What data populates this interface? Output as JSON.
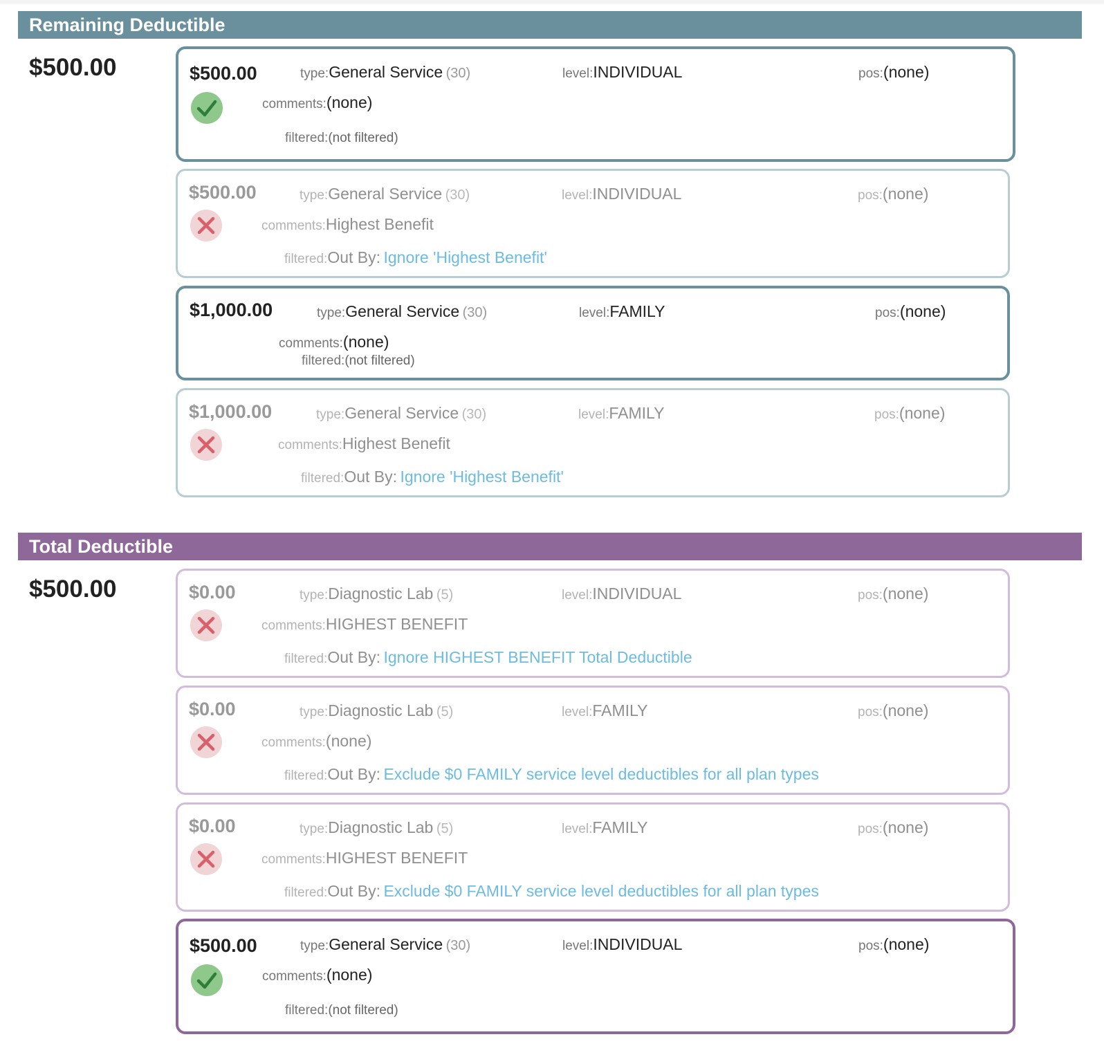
{
  "colors": {
    "remaining_accent": "#6a909e",
    "remaining_faint": "#b8ccd4",
    "total_accent": "#8f689a",
    "total_faint": "#d2bcdb",
    "link": "#6cbbe0",
    "check_bg": "#8ec98b",
    "check_mark": "#2f7d3a",
    "x_bg": "#f0d4d6",
    "x_mark": "#d9606a"
  },
  "labels": {
    "type": "type:",
    "level": "level:",
    "pos": "pos:",
    "comments": "comments:",
    "filtered": "filtered:",
    "out_by": "Out By:"
  },
  "sections": [
    {
      "title": "Remaining Deductible",
      "amount": "$500.00",
      "cards": [
        {
          "amount": "$500.00",
          "type": "General Service",
          "type_code": "(30)",
          "level": "INDIVIDUAL",
          "pos": "(none)",
          "comments": "(none)",
          "filtered_text": "(not filtered)",
          "filtered_link": "",
          "status": "pass",
          "icon": "check-icon"
        },
        {
          "amount": "$500.00",
          "type": "General Service",
          "type_code": "(30)",
          "level": "INDIVIDUAL",
          "pos": "(none)",
          "comments": "Highest Benefit",
          "filtered_text": "",
          "filtered_link": "Ignore 'Highest Benefit'",
          "status": "fail",
          "icon": "x-icon"
        },
        {
          "amount": "$1,000.00",
          "type": "General Service",
          "type_code": "(30)",
          "level": "FAMILY",
          "pos": "(none)",
          "comments": "(none)",
          "filtered_text": "(not filtered)",
          "filtered_link": "",
          "status": "pass",
          "icon": ""
        },
        {
          "amount": "$1,000.00",
          "type": "General Service",
          "type_code": "(30)",
          "level": "FAMILY",
          "pos": "(none)",
          "comments": "Highest Benefit",
          "filtered_text": "",
          "filtered_link": "Ignore 'Highest Benefit'",
          "status": "fail",
          "icon": "x-icon"
        }
      ]
    },
    {
      "title": "Total Deductible",
      "amount": "$500.00",
      "cards": [
        {
          "amount": "$0.00",
          "type": "Diagnostic Lab",
          "type_code": "(5)",
          "level": "INDIVIDUAL",
          "pos": "(none)",
          "comments": "HIGHEST BENEFIT",
          "filtered_text": "",
          "filtered_link": "Ignore HIGHEST BENEFIT Total Deductible",
          "status": "fail",
          "icon": "x-icon"
        },
        {
          "amount": "$0.00",
          "type": "Diagnostic Lab",
          "type_code": "(5)",
          "level": "FAMILY",
          "pos": "(none)",
          "comments": "(none)",
          "filtered_text": "",
          "filtered_link": "Exclude $0 FAMILY service level deductibles for all plan types",
          "status": "fail",
          "icon": "x-icon"
        },
        {
          "amount": "$0.00",
          "type": "Diagnostic Lab",
          "type_code": "(5)",
          "level": "FAMILY",
          "pos": "(none)",
          "comments": "HIGHEST BENEFIT",
          "filtered_text": "",
          "filtered_link": "Exclude $0 FAMILY service level deductibles for all plan types",
          "status": "fail",
          "icon": "x-icon"
        },
        {
          "amount": "$500.00",
          "type": "General Service",
          "type_code": "(30)",
          "level": "INDIVIDUAL",
          "pos": "(none)",
          "comments": "(none)",
          "filtered_text": "(not filtered)",
          "filtered_link": "",
          "status": "pass",
          "icon": "check-icon"
        }
      ]
    }
  ]
}
